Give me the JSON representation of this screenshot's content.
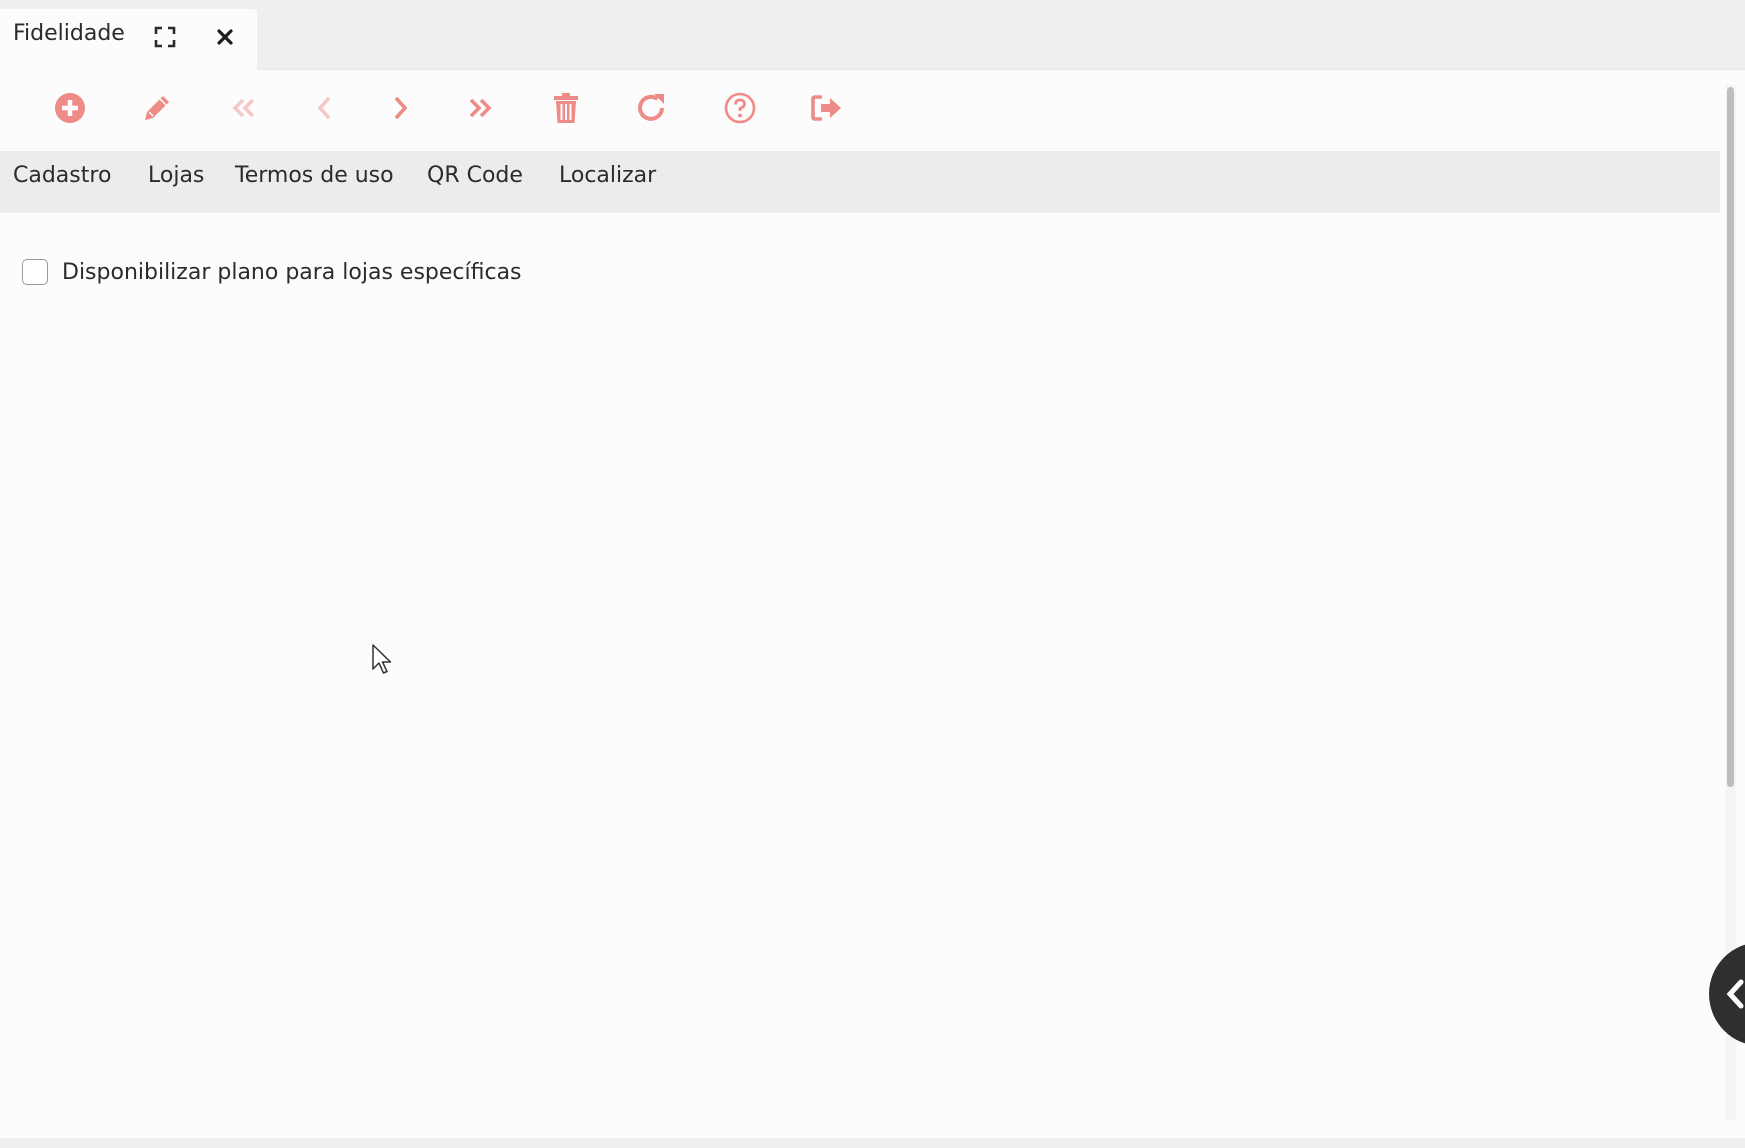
{
  "tab": {
    "title": "Fidelidade",
    "expand_icon": "expand-icon",
    "close_icon": "close-icon"
  },
  "toolbar": {
    "accent_color": "#ef8b86",
    "accent_disabled_color": "#f6c8c5",
    "buttons": [
      {
        "name": "add",
        "icon": "plus-circle-icon",
        "enabled": true
      },
      {
        "name": "edit",
        "icon": "pencil-icon",
        "enabled": true
      },
      {
        "name": "first",
        "icon": "double-chevron-left-icon",
        "enabled": false
      },
      {
        "name": "previous",
        "icon": "chevron-left-icon",
        "enabled": false
      },
      {
        "name": "next",
        "icon": "chevron-right-icon",
        "enabled": true
      },
      {
        "name": "last",
        "icon": "double-chevron-right-icon",
        "enabled": true
      },
      {
        "name": "delete",
        "icon": "trash-icon",
        "enabled": true
      },
      {
        "name": "refresh",
        "icon": "refresh-icon",
        "enabled": true
      },
      {
        "name": "help",
        "icon": "question-circle-icon",
        "enabled": true
      },
      {
        "name": "exit",
        "icon": "sign-out-icon",
        "enabled": true
      }
    ]
  },
  "menu": {
    "items": [
      "Cadastro",
      "Lojas",
      "Termos de uso",
      "QR Code",
      "Localizar"
    ]
  },
  "content": {
    "checkbox_label": "Disponibilizar plano para lojas específicas",
    "checkbox_checked": false
  },
  "float_button": {
    "icon": "chevron-left-icon"
  }
}
